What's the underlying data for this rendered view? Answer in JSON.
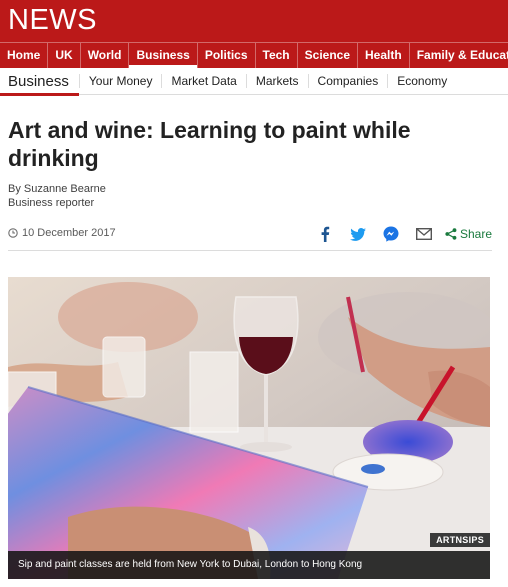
{
  "brand": {
    "logo_text": "NEWS",
    "accent": "#bb1919"
  },
  "top_nav": [
    {
      "label": "Home",
      "active": false
    },
    {
      "label": "UK",
      "active": false
    },
    {
      "label": "World",
      "active": false
    },
    {
      "label": "Business",
      "active": true
    },
    {
      "label": "Politics",
      "active": false
    },
    {
      "label": "Tech",
      "active": false
    },
    {
      "label": "Science",
      "active": false
    },
    {
      "label": "Health",
      "active": false
    },
    {
      "label": "Family & Education",
      "active": false
    }
  ],
  "sub_nav": {
    "section": "Business",
    "links": [
      "Your Money",
      "Market Data",
      "Markets",
      "Companies",
      "Economy"
    ]
  },
  "article": {
    "headline": "Art and wine: Learning to paint while drinking",
    "author": "By Suzanne Bearne",
    "role": "Business reporter",
    "date": "10 December 2017",
    "share_label": "Share",
    "share_icons": [
      "facebook-icon",
      "twitter-icon",
      "messenger-icon",
      "email-icon",
      "share-icon"
    ]
  },
  "image": {
    "credit": "ARTNSIPS",
    "caption": "Sip and paint classes are held from New York to Dubai, London to Hong Kong"
  }
}
